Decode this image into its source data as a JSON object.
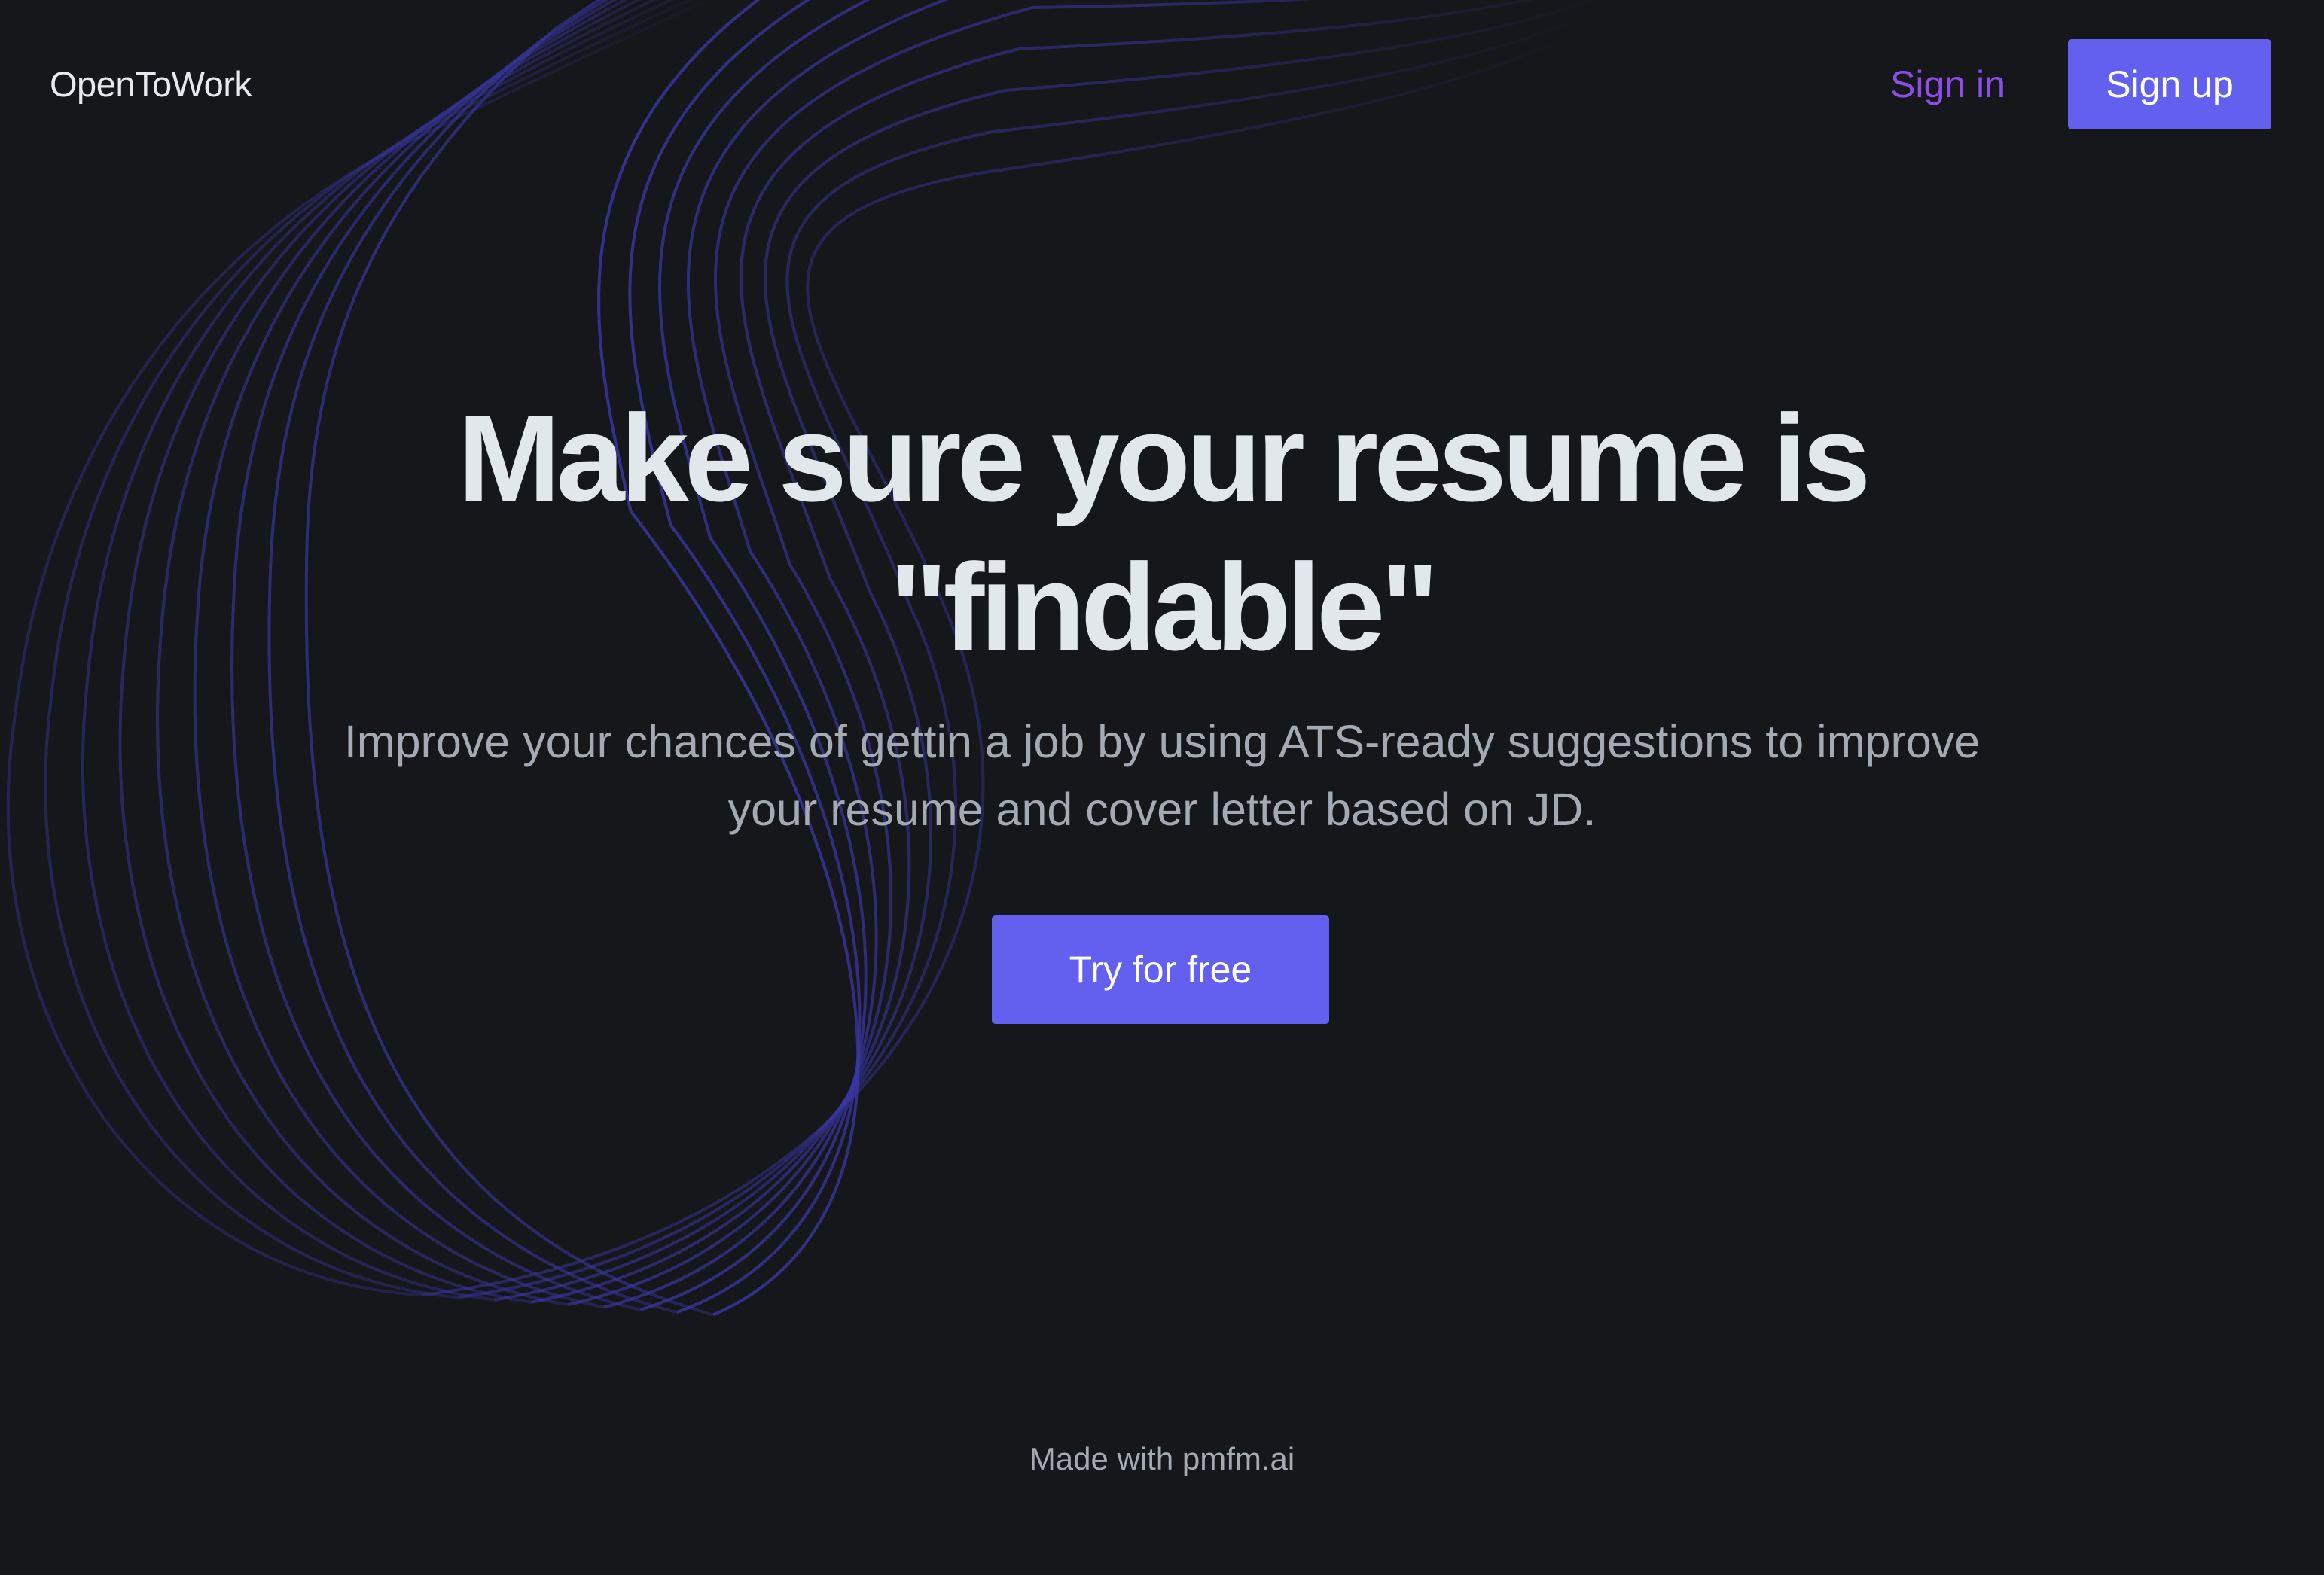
{
  "nav": {
    "brand": "OpenToWork",
    "sign_in_label": "Sign in",
    "sign_up_label": "Sign up"
  },
  "hero": {
    "headline_line1": "Make sure your resume is",
    "headline_line2": "\"findable\"",
    "subhead_line1": "Improve your chances of gettin a job by using ATS-ready suggestions to improve",
    "subhead_line2": "your resume and cover letter based on JD.",
    "cta_label": "Try for free"
  },
  "footer": {
    "credit": "Made with pmfm.ai"
  },
  "colors": {
    "background": "#16171a",
    "accent": "#6360f0",
    "sign_in_text": "#8b4ee8",
    "headline_text": "#e2e7ec",
    "muted_text": "#a3aab4",
    "wave_lines": "#3a37a8"
  }
}
